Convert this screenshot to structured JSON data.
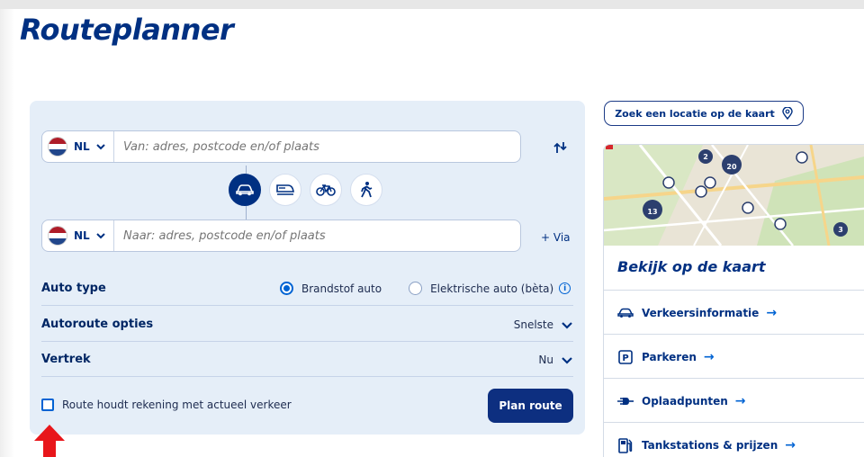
{
  "page": {
    "title": "Routeplanner"
  },
  "planner": {
    "from": {
      "country_code": "NL",
      "placeholder": "Van: adres, postcode en/of plaats"
    },
    "to": {
      "country_code": "NL",
      "placeholder": "Naar: adres, postcode en/of plaats"
    },
    "via_label": "+ Via",
    "modes": [
      {
        "icon": "car-icon",
        "active": true
      },
      {
        "icon": "train-icon",
        "active": false
      },
      {
        "icon": "bicycle-icon",
        "active": false
      },
      {
        "icon": "walking-icon",
        "active": false
      }
    ],
    "auto_type": {
      "label": "Auto type",
      "options": [
        {
          "label": "Brandstof auto",
          "selected": true
        },
        {
          "label": "Elektrische auto (bèta)",
          "selected": false
        }
      ]
    },
    "route_options": {
      "label": "Autoroute opties",
      "value": "Snelste"
    },
    "departure": {
      "label": "Vertrek",
      "value": "Nu"
    },
    "traffic_checkbox": {
      "label": "Route houdt rekening met actueel verkeer",
      "checked": false
    },
    "plan_button": "Plan route"
  },
  "sidebar": {
    "search_map_button": "Zoek een locatie op de kaart",
    "map_title": "Bekijk op de kaart",
    "map_markers": [
      "20",
      "13",
      "2",
      "3"
    ],
    "links": [
      {
        "label": "Verkeersinformatie",
        "icon": "car-icon"
      },
      {
        "label": "Parkeren",
        "icon": "parking-icon"
      },
      {
        "label": "Oplaadpunten",
        "icon": "charging-plug-icon"
      },
      {
        "label": "Tankstations & prijzen",
        "icon": "fuel-pump-icon"
      }
    ]
  },
  "colors": {
    "brand_blue": "#003082",
    "accent_blue": "#0063d3",
    "panel_bg": "#e5eef8",
    "annotation_red": "#e8161b"
  }
}
